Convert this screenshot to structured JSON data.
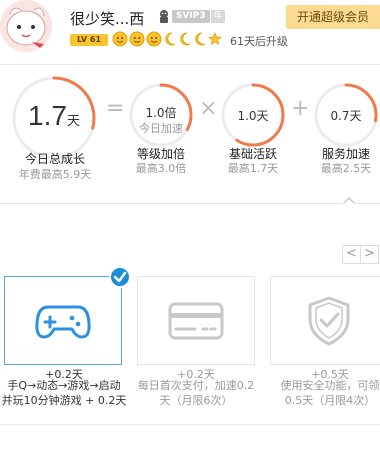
{
  "header": {
    "username": "很少笑...西",
    "svip_badge": "SVIP3",
    "year_badge": "年",
    "upgrade_button": "开通超级会员",
    "level_badge": "LV 61",
    "levelup_text": "61天后升级",
    "level_icons": [
      "sun-icon",
      "sun-icon",
      "sun-icon",
      "moon-icon",
      "moon-icon",
      "moon-icon",
      "star-icon"
    ]
  },
  "growth": {
    "total": {
      "value": "1.7",
      "unit": "天",
      "label": "今日总成长",
      "sub": "年费最高5.9天",
      "fill": 0.29
    },
    "operators": [
      "=",
      "×",
      "+"
    ],
    "multiplier": {
      "value": "1.0倍",
      "inner_sub": "今日加速",
      "label": "等级加倍",
      "sub": "最高3.0倍",
      "fill": 0.33
    },
    "base": {
      "value": "1.0天",
      "label": "基础活跃",
      "sub": "最高1.7天",
      "fill": 0.59
    },
    "service": {
      "value": "0.7天",
      "label": "服务加速",
      "sub": "最高2.5天",
      "fill": 0.28
    }
  },
  "pager": {
    "prev": "<",
    "next": ">"
  },
  "tasks": [
    {
      "bonus": "+0.2天",
      "desc_line1": "手Q→动态→游戏→启动",
      "desc_line2": "并玩10分钟游戏 + 0.2天",
      "done": true,
      "icon": "gamepad-icon"
    },
    {
      "bonus": "+0.2天",
      "desc_line1": "每日首次支付，加速0.2",
      "desc_line2": "天（月限6次）",
      "done": false,
      "icon": "credit-card-icon"
    },
    {
      "bonus": "+0.5天",
      "desc_line1": "使用安全功能，可领",
      "desc_line2": "0.5天（月限4次）",
      "done": false,
      "icon": "shield-check-icon"
    }
  ],
  "colors": {
    "accent_orange": "#f07a4a",
    "accent_blue": "#1a8cd8",
    "upgrade_gold": "#fadb91"
  }
}
